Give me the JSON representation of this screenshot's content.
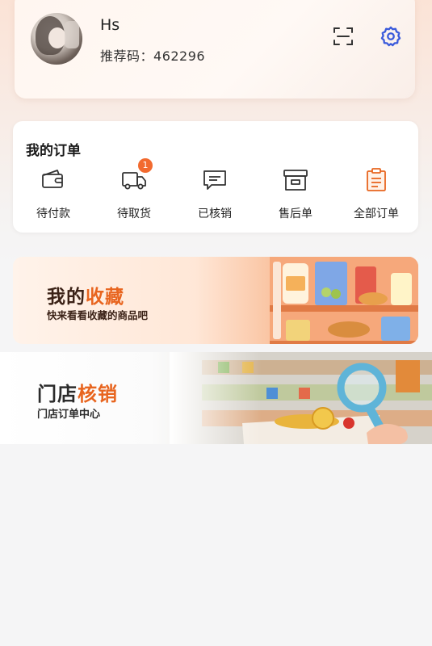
{
  "user": {
    "name": "Hs",
    "referral_label": "推荐码：",
    "referral_code": "462296"
  },
  "header_icons": {
    "scan": "scan-icon",
    "settings": "gear-icon",
    "settings_color": "#3b5bdb"
  },
  "orders": {
    "title": "我的订单",
    "items": [
      {
        "label": "待付款",
        "icon": "wallet-icon"
      },
      {
        "label": "待取货",
        "icon": "truck-icon",
        "badge": "1"
      },
      {
        "label": "已核销",
        "icon": "message-icon"
      },
      {
        "label": "售后单",
        "icon": "box-icon"
      },
      {
        "label": "全部订单",
        "icon": "clipboard-icon"
      }
    ]
  },
  "favorites_banner": {
    "title_main": "我的",
    "title_highlight": "收藏",
    "subtitle": "快来看看收藏的商品吧"
  },
  "store_banner": {
    "title_main": "门店",
    "title_highlight": "核销",
    "subtitle": "门店订单中心"
  },
  "colors": {
    "accent": "#e8651f",
    "badge": "#f26a2f",
    "page_bg": "#f5f5f6"
  }
}
